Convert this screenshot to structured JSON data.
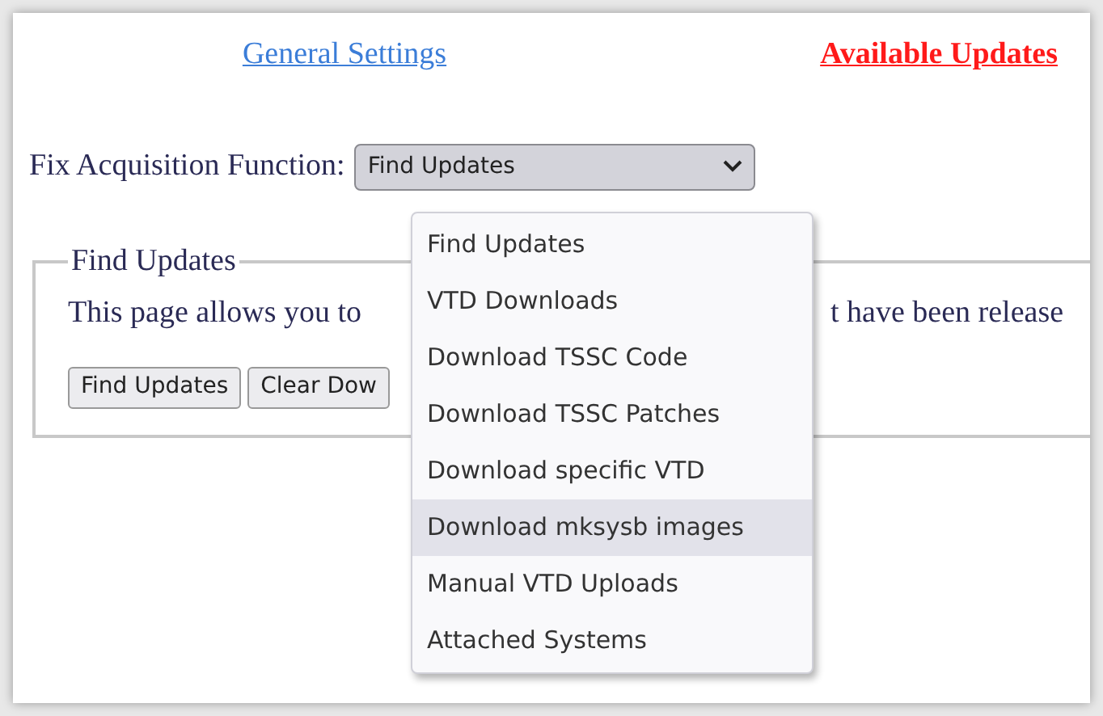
{
  "links": [
    {
      "label": "General Settings",
      "selected": false
    },
    {
      "label": "Available Updates",
      "selected": true
    }
  ],
  "function_select": {
    "label": "Fix Acquisition Function:",
    "value": "Find Updates",
    "expanded": true,
    "options": [
      {
        "label": "Find Updates",
        "highlighted": false
      },
      {
        "label": "VTD Downloads",
        "highlighted": false
      },
      {
        "label": "Download TSSC Code",
        "highlighted": false
      },
      {
        "label": "Download TSSC Patches",
        "highlighted": false
      },
      {
        "label": "Download specific VTD",
        "highlighted": false
      },
      {
        "label": "Download mksysb images",
        "highlighted": true
      },
      {
        "label": "Manual VTD Uploads",
        "highlighted": false
      },
      {
        "label": "Attached Systems",
        "highlighted": false
      }
    ]
  },
  "fieldset": {
    "legend": "Find Updates",
    "text_start": "This page allows you to",
    "text_end": "t have been release",
    "buttons": [
      "Find Updates",
      "Clear Dow"
    ]
  }
}
